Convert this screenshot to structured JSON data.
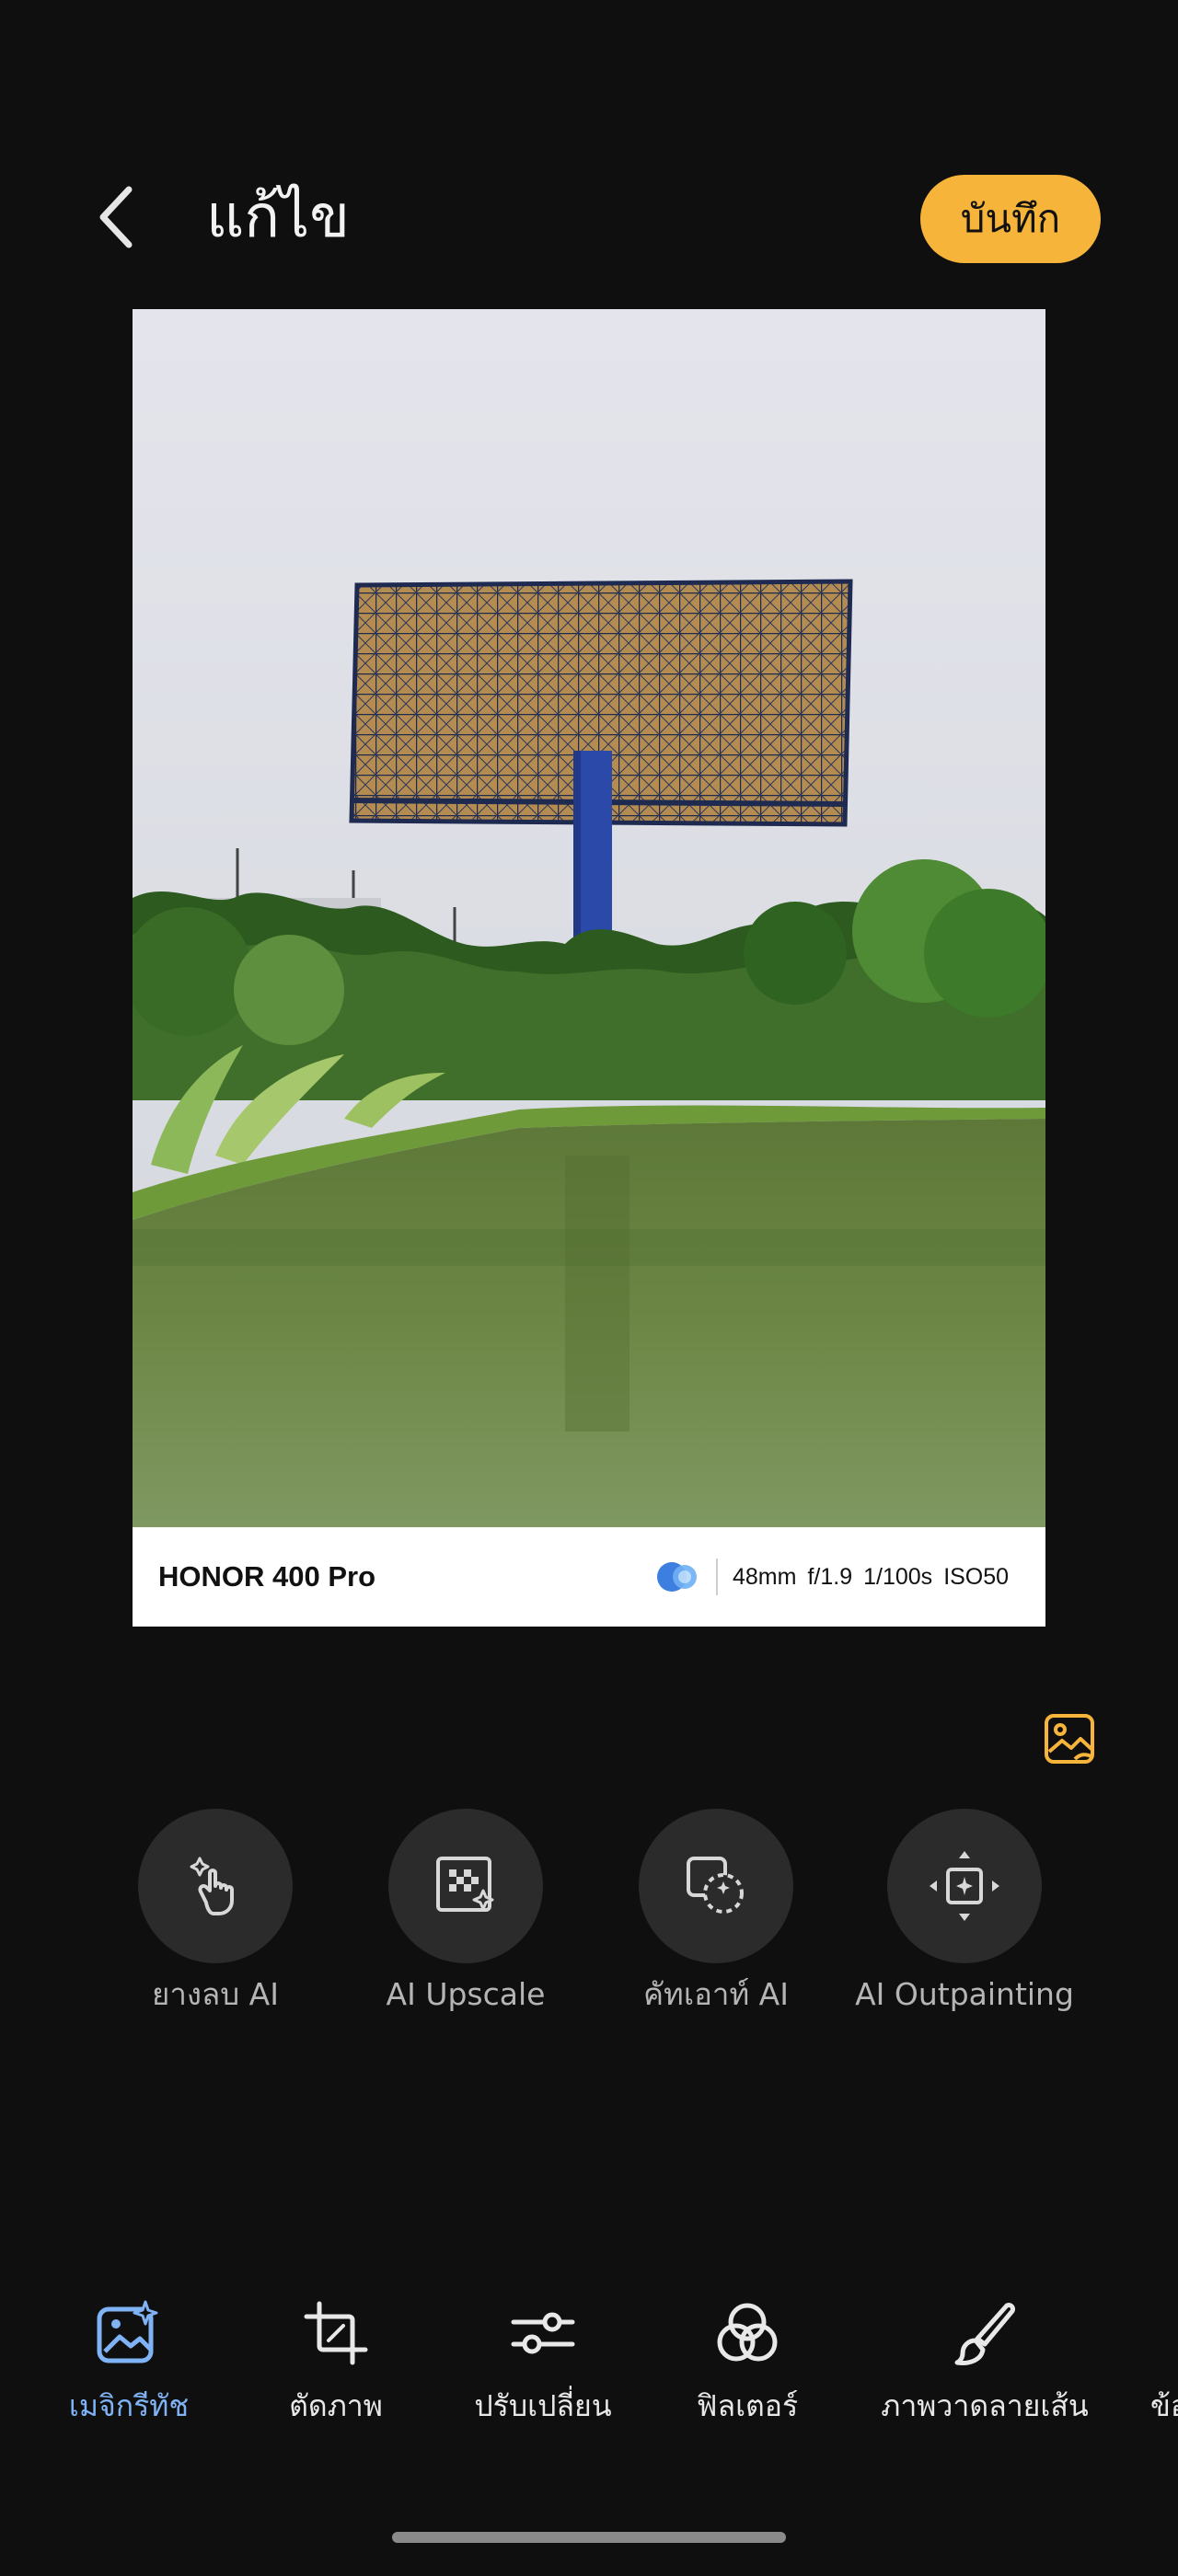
{
  "header": {
    "title": "แก้ไข",
    "save_label": "บันทึก"
  },
  "photo": {
    "description_icon": "billboard-photo",
    "watermark": {
      "model": "HONOR 400 Pro",
      "focal_length": "48mm",
      "aperture": "f/1.9",
      "shutter": "1/100s",
      "iso": "ISO50"
    }
  },
  "ai_tools": [
    {
      "label": "ยางลบ AI",
      "icon": "ai-eraser-icon"
    },
    {
      "label": "AI Upscale",
      "icon": "ai-upscale-icon"
    },
    {
      "label": "คัทเอาท์ AI",
      "icon": "ai-cutout-icon"
    },
    {
      "label": "AI Outpainting",
      "icon": "ai-outpainting-icon"
    }
  ],
  "tabs": [
    {
      "label": "เมจิกรีทัช",
      "icon": "magic-retouch-icon",
      "active": true
    },
    {
      "label": "ตัดภาพ",
      "icon": "crop-icon",
      "active": false
    },
    {
      "label": "ปรับเปลี่ยน",
      "icon": "adjust-icon",
      "active": false
    },
    {
      "label": "ฟิลเตอร์",
      "icon": "filter-icon",
      "active": false
    },
    {
      "label": "ภาพวาดลายเส้น",
      "icon": "brush-icon",
      "active": false
    },
    {
      "label": "ข้อ",
      "icon": "text-icon",
      "active": false
    }
  ],
  "colors": {
    "background": "#0f0f0f",
    "accent": "#f6b43a",
    "active_tab": "#7fb3f5",
    "tool_circle": "#2b2b2b"
  }
}
